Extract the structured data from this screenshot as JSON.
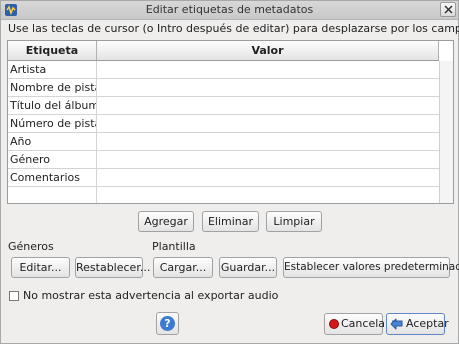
{
  "window": {
    "title": "Editar etiquetas de metadatos"
  },
  "instructions": "Use las teclas de cursor (o Intro después de editar) para desplazarse por los campos.",
  "grid": {
    "columns": [
      "Etiqueta",
      "Valor"
    ],
    "rows": [
      {
        "label": "Artista",
        "value": ""
      },
      {
        "label": "Nombre de pista",
        "value": ""
      },
      {
        "label": "Título del álbum",
        "value": ""
      },
      {
        "label": "Número de pista",
        "value": ""
      },
      {
        "label": "Año",
        "value": ""
      },
      {
        "label": "Género",
        "value": ""
      },
      {
        "label": "Comentarios",
        "value": ""
      },
      {
        "label": "",
        "value": ""
      }
    ]
  },
  "row_actions": {
    "add": "Agregar",
    "remove": "Eliminar",
    "clear": "Limpiar"
  },
  "genres": {
    "label": "Géneros",
    "edit": "Editar...",
    "reset": "Restablecer..."
  },
  "template": {
    "label": "Plantilla",
    "load": "Cargar...",
    "save": "Guardar...",
    "set_default": "Establecer valores predeterminados"
  },
  "dont_show": {
    "label": "No mostrar esta advertencia al exportar audio",
    "checked": false
  },
  "footer": {
    "help": "?",
    "cancel": "Cancelar",
    "accept": "Aceptar"
  }
}
